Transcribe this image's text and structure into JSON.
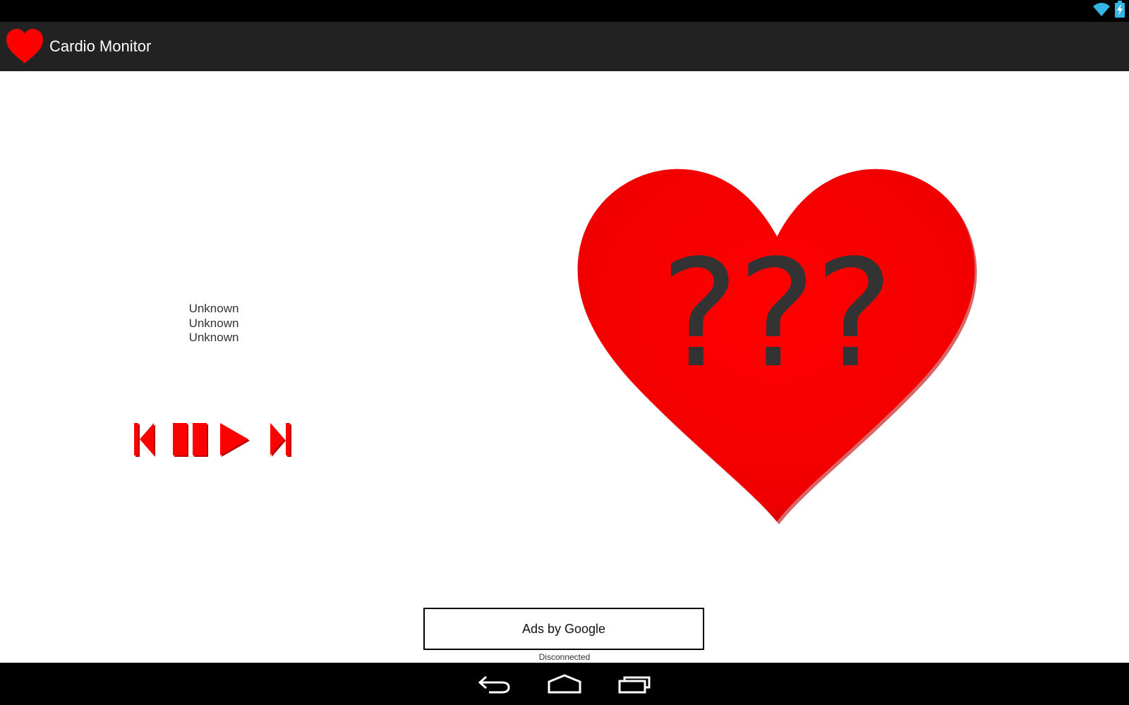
{
  "status_bar": {
    "wifi_icon": "wifi-icon",
    "battery_icon": "battery-charging-icon"
  },
  "action_bar": {
    "title": "Cardio Monitor",
    "icon": "heart-icon",
    "color": "#232222"
  },
  "player": {
    "track_lines": [
      "Unknown",
      "Unknown",
      "Unknown"
    ],
    "controls": [
      "previous-icon",
      "pause-icon",
      "play-icon",
      "next-icon"
    ],
    "accent_color": "#ff0000"
  },
  "heart_rate": {
    "value": "???",
    "color": "#ff0000"
  },
  "ad": {
    "label": "Ads by Google"
  },
  "connection": {
    "status": "Disconnected"
  },
  "nav_bar": {
    "buttons": [
      "back-icon",
      "home-icon",
      "recents-icon"
    ]
  }
}
